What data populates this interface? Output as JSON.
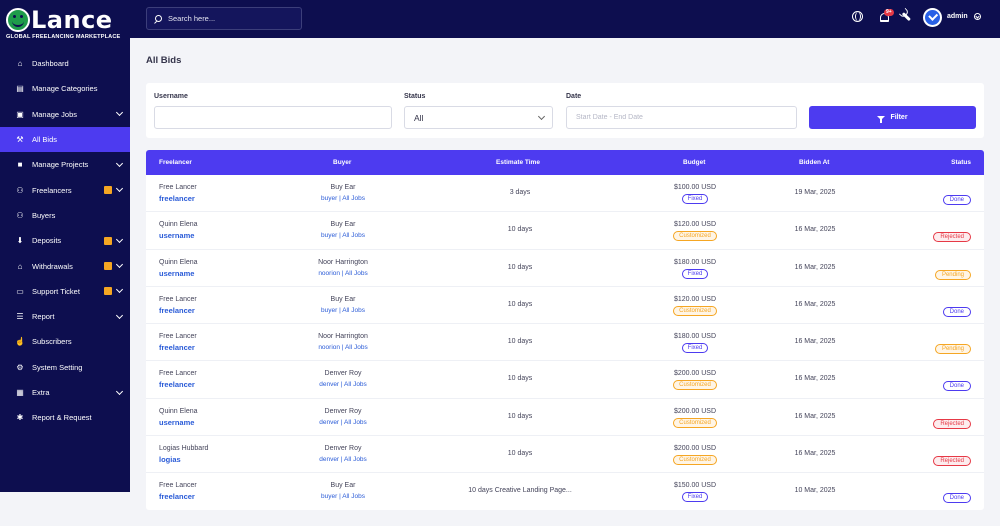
{
  "brand": {
    "name": "Lance",
    "tagline": "GLOBAL FREELANCING MARKETPLACE"
  },
  "search": {
    "placeholder": "Search here..."
  },
  "header": {
    "notification_count": "9+",
    "user_name": "admin"
  },
  "sidebar": {
    "items": [
      {
        "label": "Dashboard",
        "icon": "home-icon",
        "chevron": false,
        "badge": false
      },
      {
        "label": "Manage Categories",
        "icon": "layers-icon",
        "chevron": false,
        "badge": false
      },
      {
        "label": "Manage Jobs",
        "icon": "briefcase-icon",
        "chevron": true,
        "badge": false
      },
      {
        "label": "All Bids",
        "icon": "gavel-icon",
        "chevron": false,
        "badge": false,
        "active": true
      },
      {
        "label": "Manage Projects",
        "icon": "folder-icon",
        "chevron": true,
        "badge": false
      },
      {
        "label": "Freelancers",
        "icon": "users-icon",
        "chevron": true,
        "badge": true
      },
      {
        "label": "Buyers",
        "icon": "user-group-icon",
        "chevron": false,
        "badge": false
      },
      {
        "label": "Deposits",
        "icon": "deposit-icon",
        "chevron": true,
        "badge": true
      },
      {
        "label": "Withdrawals",
        "icon": "bank-icon",
        "chevron": true,
        "badge": true
      },
      {
        "label": "Support Ticket",
        "icon": "ticket-icon",
        "chevron": true,
        "badge": true
      },
      {
        "label": "Report",
        "icon": "list-icon",
        "chevron": true,
        "badge": false
      },
      {
        "label": "Subscribers",
        "icon": "thumbs-up-icon",
        "chevron": false,
        "badge": false
      },
      {
        "label": "System Setting",
        "icon": "gear-icon",
        "chevron": false,
        "badge": false
      },
      {
        "label": "Extra",
        "icon": "grid-icon",
        "chevron": true,
        "badge": false
      },
      {
        "label": "Report & Request",
        "icon": "bug-icon",
        "chevron": false,
        "badge": false
      }
    ]
  },
  "page": {
    "title": "All Bids"
  },
  "filters": {
    "username_label": "Username",
    "username_value": "",
    "status_label": "Status",
    "status_value": "All",
    "date_label": "Date",
    "date_placeholder": "Start Date - End Date",
    "filter_button": "Filter"
  },
  "table": {
    "headers": [
      "Freelancer",
      "Buyer",
      "Estimate Time",
      "Budget",
      "Bidden At",
      "Status"
    ],
    "rows": [
      {
        "freelancer_name": "Free Lancer",
        "freelancer_user": "freelancer",
        "buyer_name": "Buy Ear",
        "buyer_links": "buyer | All Jobs",
        "estimate": "3 days",
        "budget": "$100.00 USD",
        "type": "Fixed",
        "bidden_at": "19 Mar, 2025",
        "status": "Done"
      },
      {
        "freelancer_name": "Quinn Elena",
        "freelancer_user": "username",
        "buyer_name": "Buy Ear",
        "buyer_links": "buyer | All Jobs",
        "estimate": "10 days",
        "budget": "$120.00 USD",
        "type": "Customized",
        "bidden_at": "16 Mar, 2025",
        "status": "Rejected"
      },
      {
        "freelancer_name": "Quinn Elena",
        "freelancer_user": "username",
        "buyer_name": "Noor Harrington",
        "buyer_links": "noorion | All Jobs",
        "estimate": "10 days",
        "budget": "$180.00 USD",
        "type": "Fixed",
        "bidden_at": "16 Mar, 2025",
        "status": "Pending"
      },
      {
        "freelancer_name": "Free Lancer",
        "freelancer_user": "freelancer",
        "buyer_name": "Buy Ear",
        "buyer_links": "buyer | All Jobs",
        "estimate": "10 days",
        "budget": "$120.00 USD",
        "type": "Customized",
        "bidden_at": "16 Mar, 2025",
        "status": "Done"
      },
      {
        "freelancer_name": "Free Lancer",
        "freelancer_user": "freelancer",
        "buyer_name": "Noor Harrington",
        "buyer_links": "noorion | All Jobs",
        "estimate": "10 days",
        "budget": "$180.00 USD",
        "type": "Fixed",
        "bidden_at": "16 Mar, 2025",
        "status": "Pending"
      },
      {
        "freelancer_name": "Free Lancer",
        "freelancer_user": "freelancer",
        "buyer_name": "Denver Roy",
        "buyer_links": "denver | All Jobs",
        "estimate": "10 days",
        "budget": "$200.00 USD",
        "type": "Customized",
        "bidden_at": "16 Mar, 2025",
        "status": "Done"
      },
      {
        "freelancer_name": "Quinn Elena",
        "freelancer_user": "username",
        "buyer_name": "Denver Roy",
        "buyer_links": "denver | All Jobs",
        "estimate": "10 days",
        "budget": "$200.00 USD",
        "type": "Customized",
        "bidden_at": "16 Mar, 2025",
        "status": "Rejected"
      },
      {
        "freelancer_name": "Logias Hubbard",
        "freelancer_user": "logias",
        "buyer_name": "Denver Roy",
        "buyer_links": "denver | All Jobs",
        "estimate": "10 days",
        "budget": "$200.00 USD",
        "type": "Customized",
        "bidden_at": "16 Mar, 2025",
        "status": "Rejected"
      },
      {
        "freelancer_name": "Free Lancer",
        "freelancer_user": "freelancer",
        "buyer_name": "Buy Ear",
        "buyer_links": "buyer | All Jobs",
        "estimate": "10 days Creative Landing Page...",
        "budget": "$150.00 USD",
        "type": "Fixed",
        "bidden_at": "10 Mar, 2025",
        "status": "Done"
      }
    ]
  },
  "colors": {
    "nav_bg": "#0d0e4f",
    "accent": "#4d3bf0",
    "link": "#2a5bd7",
    "warning": "#f5a623",
    "danger": "#e63946"
  }
}
